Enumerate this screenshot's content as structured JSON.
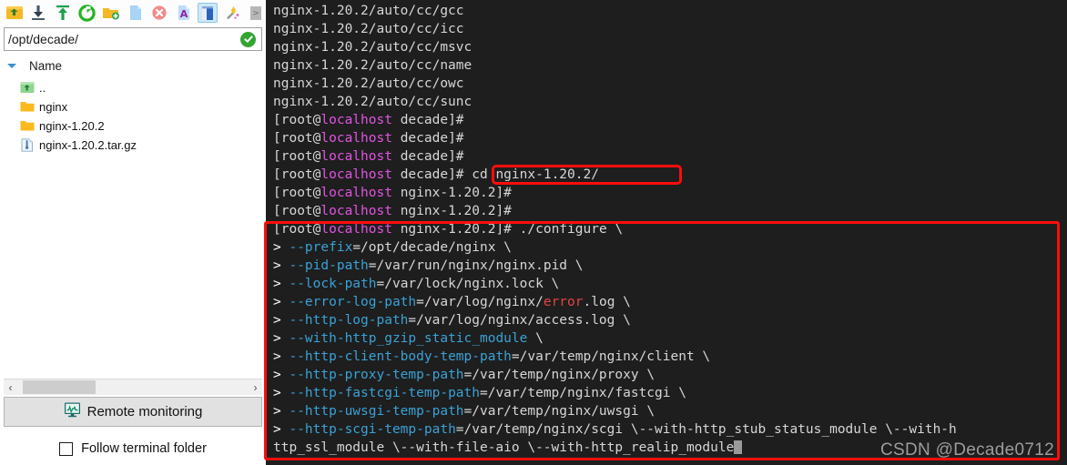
{
  "left_panel": {
    "toolbar": {
      "buttons": [
        {
          "name": "parent-folder-icon",
          "title": "Up one level"
        },
        {
          "name": "download-icon",
          "title": "Download"
        },
        {
          "name": "upload-icon",
          "title": "Upload"
        },
        {
          "name": "refresh-icon",
          "title": "Refresh"
        },
        {
          "name": "new-folder-icon",
          "title": "New folder"
        },
        {
          "name": "new-file-icon",
          "title": "New file"
        },
        {
          "name": "delete-icon",
          "title": "Delete"
        },
        {
          "name": "rename-icon",
          "title": "Rename"
        },
        {
          "name": "edit-file-icon",
          "title": "Edit"
        },
        {
          "name": "magic-wand-icon",
          "title": "Tools"
        },
        {
          "name": "more-icon",
          "title": "More"
        }
      ]
    },
    "path_bar": {
      "value": "/opt/decade/",
      "placeholder": "/",
      "status_icon": "check-circle-icon"
    },
    "tree": {
      "expander_icon": "chevron-down-icon",
      "column_header": "Name",
      "rows": [
        {
          "icon": "parent-folder-icon",
          "name": ".."
        },
        {
          "icon": "folder-icon",
          "name": "nginx"
        },
        {
          "icon": "folder-icon",
          "name": "nginx-1.20.2"
        },
        {
          "icon": "archive-file-icon",
          "name": "nginx-1.20.2.tar.gz"
        }
      ]
    },
    "hscrollbar": {
      "left_arrow": "‹",
      "right_arrow": "›"
    },
    "remote_monitoring_button": {
      "icon": "monitor-chart-icon",
      "label": "Remote monitoring"
    },
    "follow_terminal_folder": {
      "label": "Follow terminal folder",
      "checked": false
    }
  },
  "terminal": {
    "prompt_user": "root",
    "prompt_host": "localhost",
    "watermark": "CSDN @Decade0712",
    "lines": [
      {
        "segs": [
          {
            "t": "nginx-1.20.2/auto/cc/gcc",
            "c": "c-def"
          }
        ]
      },
      {
        "segs": [
          {
            "t": "nginx-1.20.2/auto/cc/icc",
            "c": "c-def"
          }
        ]
      },
      {
        "segs": [
          {
            "t": "nginx-1.20.2/auto/cc/msvc",
            "c": "c-def"
          }
        ]
      },
      {
        "segs": [
          {
            "t": "nginx-1.20.2/auto/cc/name",
            "c": "c-def"
          }
        ]
      },
      {
        "segs": [
          {
            "t": "nginx-1.20.2/auto/cc/owc",
            "c": "c-def"
          }
        ]
      },
      {
        "segs": [
          {
            "t": "nginx-1.20.2/auto/cc/sunc",
            "c": "c-def"
          }
        ]
      },
      {
        "segs": [
          {
            "t": "[root@",
            "c": "c-def"
          },
          {
            "t": "localhost",
            "c": "c-host"
          },
          {
            "t": " decade]#",
            "c": "c-def"
          }
        ]
      },
      {
        "segs": [
          {
            "t": "[root@",
            "c": "c-def"
          },
          {
            "t": "localhost",
            "c": "c-host"
          },
          {
            "t": " decade]#",
            "c": "c-def"
          }
        ]
      },
      {
        "segs": [
          {
            "t": "[root@",
            "c": "c-def"
          },
          {
            "t": "localhost",
            "c": "c-host"
          },
          {
            "t": " decade]#",
            "c": "c-def"
          }
        ]
      },
      {
        "segs": [
          {
            "t": "[root@",
            "c": "c-def"
          },
          {
            "t": "localhost",
            "c": "c-host"
          },
          {
            "t": " decade]# cd nginx-1.20.2/",
            "c": "c-def"
          }
        ]
      },
      {
        "segs": [
          {
            "t": "[root@",
            "c": "c-def"
          },
          {
            "t": "localhost",
            "c": "c-host"
          },
          {
            "t": " nginx-1.20.2]#",
            "c": "c-def"
          }
        ]
      },
      {
        "segs": [
          {
            "t": "[root@",
            "c": "c-def"
          },
          {
            "t": "localhost",
            "c": "c-host"
          },
          {
            "t": " nginx-1.20.2]#",
            "c": "c-def"
          }
        ]
      },
      {
        "segs": [
          {
            "t": "[root@",
            "c": "c-def"
          },
          {
            "t": "localhost",
            "c": "c-host"
          },
          {
            "t": " nginx-1.20.2]# ./configure \\",
            "c": "c-def"
          }
        ]
      },
      {
        "segs": [
          {
            "t": "> ",
            "c": "c-gt"
          },
          {
            "t": "--prefix",
            "c": "c-opt"
          },
          {
            "t": "=/opt/decade/nginx \\",
            "c": "c-def"
          }
        ]
      },
      {
        "segs": [
          {
            "t": "> ",
            "c": "c-gt"
          },
          {
            "t": "--pid-path",
            "c": "c-opt"
          },
          {
            "t": "=/var/run/nginx/nginx.pid \\",
            "c": "c-def"
          }
        ]
      },
      {
        "segs": [
          {
            "t": "> ",
            "c": "c-gt"
          },
          {
            "t": "--lock-path",
            "c": "c-opt"
          },
          {
            "t": "=/var/lock/nginx.lock \\",
            "c": "c-def"
          }
        ]
      },
      {
        "segs": [
          {
            "t": "> ",
            "c": "c-gt"
          },
          {
            "t": "--error-log-path",
            "c": "c-opt"
          },
          {
            "t": "=/var/log/nginx/",
            "c": "c-def"
          },
          {
            "t": "error",
            "c": "c-err"
          },
          {
            "t": ".log \\",
            "c": "c-def"
          }
        ]
      },
      {
        "segs": [
          {
            "t": "> ",
            "c": "c-gt"
          },
          {
            "t": "--http-log-path",
            "c": "c-opt"
          },
          {
            "t": "=/var/log/nginx/access.log \\",
            "c": "c-def"
          }
        ]
      },
      {
        "segs": [
          {
            "t": "> ",
            "c": "c-gt"
          },
          {
            "t": "--with-http_gzip_static_module",
            "c": "c-opt"
          },
          {
            "t": " \\",
            "c": "c-def"
          }
        ]
      },
      {
        "segs": [
          {
            "t": "> ",
            "c": "c-gt"
          },
          {
            "t": "--http-client-body-temp-path",
            "c": "c-opt"
          },
          {
            "t": "=/var/temp/nginx/client \\",
            "c": "c-def"
          }
        ]
      },
      {
        "segs": [
          {
            "t": "> ",
            "c": "c-gt"
          },
          {
            "t": "--http-proxy-temp-path",
            "c": "c-opt"
          },
          {
            "t": "=/var/temp/nginx/proxy \\",
            "c": "c-def"
          }
        ]
      },
      {
        "segs": [
          {
            "t": "> ",
            "c": "c-gt"
          },
          {
            "t": "--http-fastcgi-temp-path",
            "c": "c-opt"
          },
          {
            "t": "=/var/temp/nginx/fastcgi \\",
            "c": "c-def"
          }
        ]
      },
      {
        "segs": [
          {
            "t": "> ",
            "c": "c-gt"
          },
          {
            "t": "--http-uwsgi-temp-path",
            "c": "c-opt"
          },
          {
            "t": "=/var/temp/nginx/uwsgi \\",
            "c": "c-def"
          }
        ]
      },
      {
        "segs": [
          {
            "t": "> ",
            "c": "c-gt"
          },
          {
            "t": "--http-scgi-temp-path",
            "c": "c-opt"
          },
          {
            "t": "=/var/temp/nginx/scgi \\--with-http_stub_status_module \\--with-h",
            "c": "c-def"
          }
        ]
      },
      {
        "segs": [
          {
            "t": "ttp_ssl_module \\--with-file-aio \\--with-http_realip_module",
            "c": "c-def"
          }
        ],
        "cursor": true
      }
    ]
  },
  "highlights": [
    {
      "name": "cd-command-highlight",
      "color": "#fd0d0d"
    },
    {
      "name": "configure-command-highlight",
      "color": "#fd0d0d"
    }
  ]
}
